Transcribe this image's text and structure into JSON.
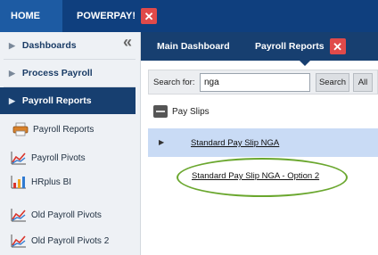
{
  "topbar": {
    "home_label": "HOME",
    "powerpay_label": "POWERPAY!",
    "powerpay_close": "✕"
  },
  "sidebar": {
    "collapse_glyph": "«",
    "nav": [
      {
        "label": "Dashboards"
      },
      {
        "label": "Process Payroll"
      },
      {
        "label": "Payroll Reports"
      }
    ],
    "sub_items": [
      {
        "label": "Payroll Reports",
        "icon": "printer-icon"
      },
      {
        "label": "Payroll Pivots",
        "icon": "line-chart-icon"
      },
      {
        "label": "HRplus BI",
        "icon": "bar-chart-icon"
      },
      {
        "label": "Old Payroll Pivots",
        "icon": "line-chart-icon"
      },
      {
        "label": "Old Payroll Pivots 2",
        "icon": "line-chart-icon"
      }
    ]
  },
  "main": {
    "tabs": [
      {
        "label": "Main Dashboard"
      },
      {
        "label": "Payroll Reports",
        "close": "✕"
      }
    ],
    "search": {
      "label": "Search for:",
      "value": "nga",
      "search_button": "Search",
      "all_button": "All"
    },
    "tree": {
      "group_label": "Pay Slips",
      "items": [
        {
          "label": "Standard Pay Slip NGA"
        },
        {
          "label": "Standard Pay Slip NGA - Option 2"
        }
      ]
    }
  },
  "colors": {
    "topbar": "#0f3f7e",
    "home_tab": "#1d5ba3",
    "active_nav": "#173f70",
    "close_red": "#e04a4a",
    "selected_row": "#c9dbf5",
    "highlight_oval": "#6aa72e"
  }
}
